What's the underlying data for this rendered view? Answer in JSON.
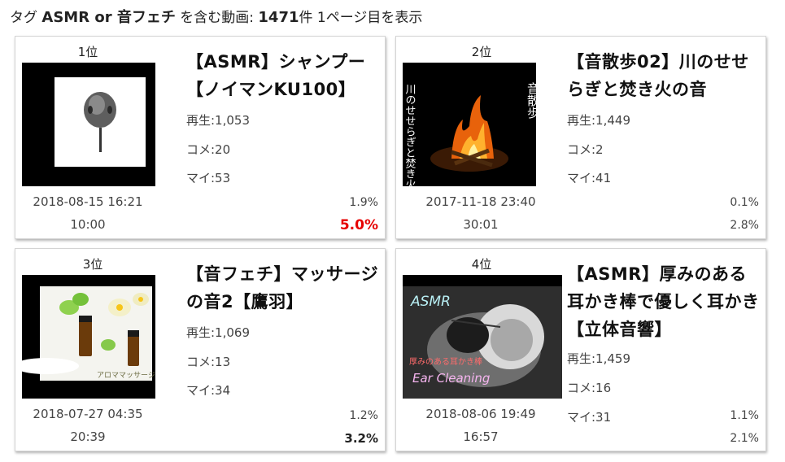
{
  "header": {
    "prefix": "タグ",
    "tag": "ASMR or 音フェチ",
    "mid": "を含む動画:",
    "count": "1471",
    "suffix": "件 1ページ目を表示"
  },
  "videos": [
    {
      "rank": "1位",
      "title": "【ASMR】シャンプー【ノイマンKU100】",
      "plays": "再生:1,053",
      "comments": "コメ:20",
      "mylist": "マイ:53",
      "date": "2018-08-15 16:21",
      "duration": "10:00",
      "pct1": "1.9%",
      "pct2": "5.0%"
    },
    {
      "rank": "2位",
      "title": "【音散歩02】川のせせらぎと焚き火の音",
      "plays": "再生:1,449",
      "comments": "コメ:2",
      "mylist": "マイ:41",
      "date": "2017-11-18 23:40",
      "duration": "30:01",
      "pct1": "0.1%",
      "pct2": "2.8%",
      "thumb_text_left": "川のせせらぎと焚き火の音",
      "thumb_text_right": "音散歩"
    },
    {
      "rank": "3位",
      "title": "【音フェチ】マッサージの音2【鷹羽】",
      "plays": "再生:1,069",
      "comments": "コメ:13",
      "mylist": "マイ:34",
      "date": "2018-07-27 04:35",
      "duration": "20:39",
      "pct1": "1.2%",
      "pct2": "3.2%",
      "thumb_text": "アロママッサージの音"
    },
    {
      "rank": "4位",
      "title": "【ASMR】厚みのある耳かき棒で優しく耳かき【立体音響】",
      "plays": "再生:1,459",
      "comments": "コメ:16",
      "mylist": "マイ:31",
      "date": "2018-08-06 19:49",
      "duration": "16:57",
      "pct1": "1.1%",
      "pct2": "2.1%",
      "thumb_text_top": "ASMR",
      "thumb_text_mid": "厚みのある耳かき棒",
      "thumb_text_bottom": "Ear Cleaning"
    }
  ],
  "colors": {
    "highlight": "#e60000"
  }
}
